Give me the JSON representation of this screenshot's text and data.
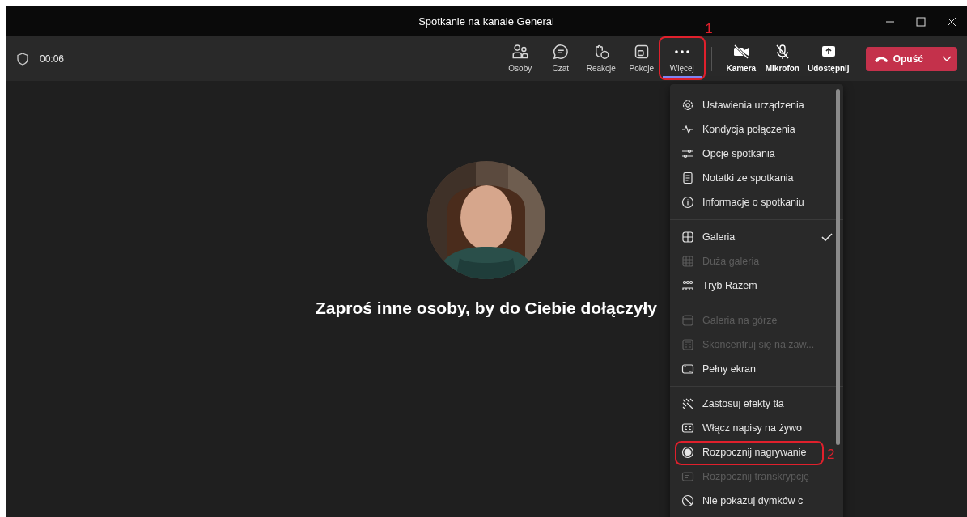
{
  "window": {
    "title": "Spotkanie na kanale General"
  },
  "call": {
    "timer": "00:06"
  },
  "toolbar": {
    "items": [
      {
        "label": "Osoby",
        "selected": false
      },
      {
        "label": "Czat",
        "selected": false
      },
      {
        "label": "Reakcje",
        "selected": false
      },
      {
        "label": "Pokoje",
        "selected": false
      },
      {
        "label": "Więcej",
        "selected": true,
        "callout": "1"
      }
    ],
    "devices": [
      {
        "label": "Kamera"
      },
      {
        "label": "Mikrofon"
      },
      {
        "label": "Udostępnij"
      }
    ],
    "leave_button": {
      "label": "Opuść"
    }
  },
  "stage": {
    "message": "Zaproś inne osoby, by do Ciebie dołączyły"
  },
  "menu": {
    "groups": [
      [
        {
          "label": "Ustawienia urządzenia",
          "disabled": false,
          "checked": false
        },
        {
          "label": "Kondycja połączenia",
          "disabled": false,
          "checked": false
        },
        {
          "label": "Opcje spotkania",
          "disabled": false,
          "checked": false
        },
        {
          "label": "Notatki ze spotkania",
          "disabled": false,
          "checked": false
        },
        {
          "label": "Informacje o spotkaniu",
          "disabled": false,
          "checked": false
        }
      ],
      [
        {
          "label": "Galeria",
          "disabled": false,
          "checked": true
        },
        {
          "label": "Duża galeria",
          "disabled": true,
          "checked": false
        },
        {
          "label": "Tryb Razem",
          "disabled": false,
          "checked": false
        }
      ],
      [
        {
          "label": "Galeria na górze",
          "disabled": true,
          "checked": false
        },
        {
          "label": "Skoncentruj się na zaw...",
          "disabled": true,
          "checked": false
        },
        {
          "label": "Pełny ekran",
          "disabled": false,
          "checked": false
        }
      ],
      [
        {
          "label": "Zastosuj efekty tła",
          "disabled": false,
          "checked": false
        },
        {
          "label": "Włącz napisy na żywo",
          "disabled": false,
          "checked": false
        },
        {
          "label": "Rozpocznij nagrywanie",
          "disabled": false,
          "checked": false,
          "callout": "2"
        },
        {
          "label": "Rozpocznij transkrypcję",
          "disabled": true,
          "checked": false
        },
        {
          "label": "Nie pokazuj dymków c",
          "disabled": false,
          "checked": false
        }
      ]
    ]
  }
}
